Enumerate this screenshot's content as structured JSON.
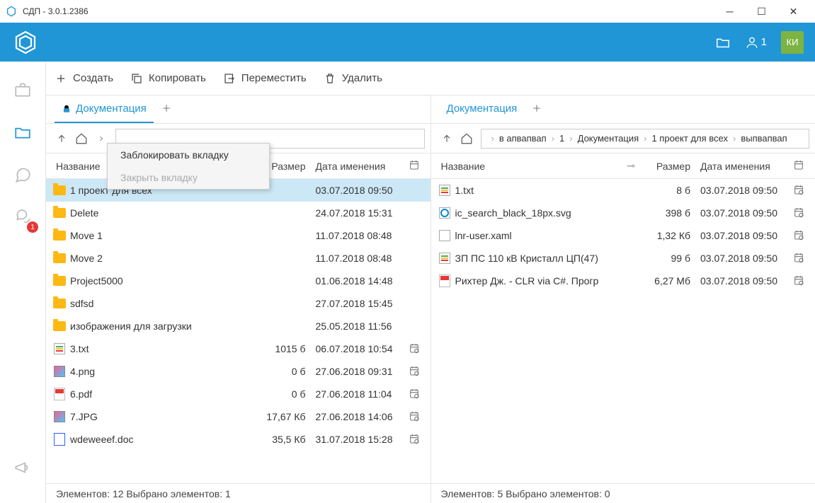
{
  "window": {
    "title": "СДП - 3.0.1.2386"
  },
  "topbar": {
    "user_count": "1",
    "avatar_initials": "КИ"
  },
  "sidebar": {
    "chat_badge": "1"
  },
  "toolbar": {
    "create": "Создать",
    "copy": "Копировать",
    "move": "Переместить",
    "delete": "Удалить"
  },
  "context_menu": {
    "lock_tab": "Заблокировать вкладку",
    "close_tab": "Закрыть вкладку"
  },
  "columns": {
    "name": "Название",
    "size": "Размер",
    "date": "Дата именения"
  },
  "left_pane": {
    "tab_label": "Документация",
    "breadcrumbs": [],
    "rows": [
      {
        "type": "folder",
        "name": "1 проект для всех",
        "size": "",
        "date": "03.07.2018 09:50",
        "cal": false,
        "selected": true
      },
      {
        "type": "folder",
        "name": "Delete",
        "size": "",
        "date": "24.07.2018 15:31",
        "cal": false
      },
      {
        "type": "folder",
        "name": "Move 1",
        "size": "",
        "date": "11.07.2018 08:48",
        "cal": false
      },
      {
        "type": "folder",
        "name": "Move 2",
        "size": "",
        "date": "11.07.2018 08:48",
        "cal": false
      },
      {
        "type": "folder",
        "name": "Project5000",
        "size": "",
        "date": "01.06.2018 14:48",
        "cal": false
      },
      {
        "type": "folder",
        "name": "sdfsd",
        "size": "",
        "date": "27.07.2018 15:45",
        "cal": false
      },
      {
        "type": "folder",
        "name": "изображения для загрузки",
        "size": "",
        "date": "25.05.2018 11:56",
        "cal": false
      },
      {
        "type": "txt",
        "name": "3.txt",
        "size": "1015 б",
        "date": "06.07.2018 10:54",
        "cal": true
      },
      {
        "type": "img",
        "name": "4.png",
        "size": "0 б",
        "date": "27.06.2018 09:31",
        "cal": true
      },
      {
        "type": "pdf",
        "name": "6.pdf",
        "size": "0 б",
        "date": "27.06.2018 11:04",
        "cal": true
      },
      {
        "type": "img",
        "name": "7.JPG",
        "size": "17,67 Кб",
        "date": "27.06.2018 14:06",
        "cal": true
      },
      {
        "type": "doc",
        "name": "wdeweeef.doc",
        "size": "35,5 Кб",
        "date": "31.07.2018 15:28",
        "cal": true
      }
    ],
    "status": "Элементов: 12  Выбрано элементов: 1"
  },
  "right_pane": {
    "tab_label": "Документация",
    "breadcrumbs": [
      "в апвапвап",
      "1",
      "Документация",
      "1 проект для всех",
      "выпвапвап"
    ],
    "rows": [
      {
        "type": "txt",
        "name": "1.txt",
        "size": "8 б",
        "date": "03.07.2018 09:50",
        "cal": true
      },
      {
        "type": "svg",
        "name": "ic_search_black_18px.svg",
        "size": "398 б",
        "date": "03.07.2018 09:50",
        "cal": true
      },
      {
        "type": "xaml",
        "name": "lnr-user.xaml",
        "size": "1,32 Кб",
        "date": "03.07.2018 09:50",
        "cal": true
      },
      {
        "type": "txt",
        "name": "ЗП ПС 110 кВ Кристалл ЦП(47)",
        "size": "99 б",
        "date": "03.07.2018 09:50",
        "cal": true
      },
      {
        "type": "pdf",
        "name": "Рихтер Дж. - CLR via C#. Прогр",
        "size": "6,27 Мб",
        "date": "03.07.2018 09:50",
        "cal": true
      }
    ],
    "status": "Элементов: 5  Выбрано элементов: 0"
  }
}
